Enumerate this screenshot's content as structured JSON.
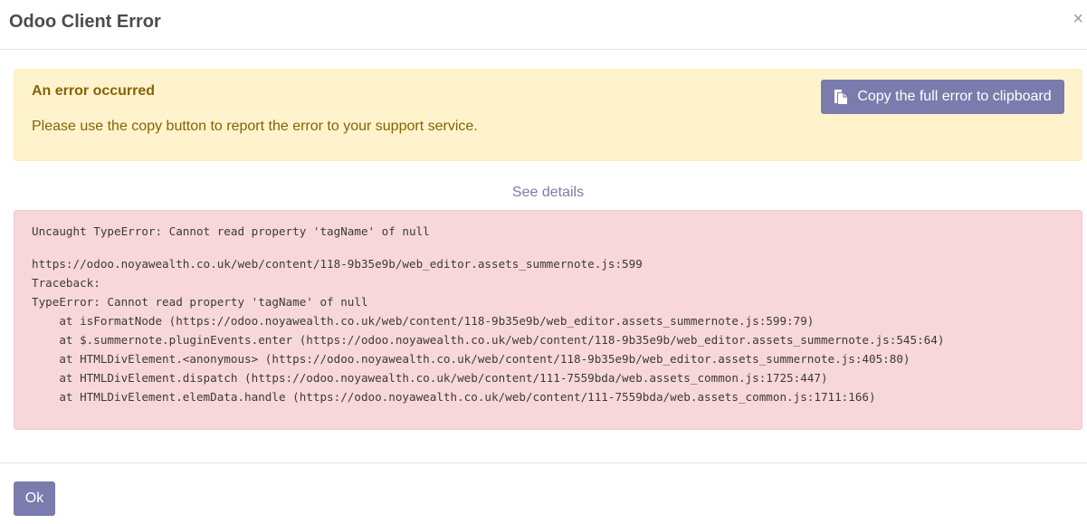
{
  "dialog": {
    "title": "Odoo Client Error",
    "close_glyph": "×"
  },
  "alert": {
    "heading": "An error occurred",
    "text": "Please use the copy button to report the error to your support service.",
    "copy_button_label": "Copy the full error to clipboard",
    "copy_icon": "clipboard-icon"
  },
  "details": {
    "toggle_label": "See details",
    "summary": "Uncaught TypeError: Cannot read property 'tagName' of null",
    "trace": [
      "https://odoo.noyawealth.co.uk/web/content/118-9b35e9b/web_editor.assets_summernote.js:599",
      "Traceback:",
      "TypeError: Cannot read property 'tagName' of null",
      "    at isFormatNode (https://odoo.noyawealth.co.uk/web/content/118-9b35e9b/web_editor.assets_summernote.js:599:79)",
      "    at $.summernote.pluginEvents.enter (https://odoo.noyawealth.co.uk/web/content/118-9b35e9b/web_editor.assets_summernote.js:545:64)",
      "    at HTMLDivElement.<anonymous> (https://odoo.noyawealth.co.uk/web/content/118-9b35e9b/web_editor.assets_summernote.js:405:80)",
      "    at HTMLDivElement.dispatch (https://odoo.noyawealth.co.uk/web/content/111-7559bda/web.assets_common.js:1725:447)",
      "    at HTMLDivElement.elemData.handle (https://odoo.noyawealth.co.uk/web/content/111-7559bda/web.assets_common.js:1711:166)"
    ]
  },
  "footer": {
    "ok_label": "Ok"
  },
  "colors": {
    "primary": "#7c7bad",
    "warning_bg": "#fff3cd",
    "warning_text": "#856404",
    "danger_bg": "#f8d7da"
  }
}
